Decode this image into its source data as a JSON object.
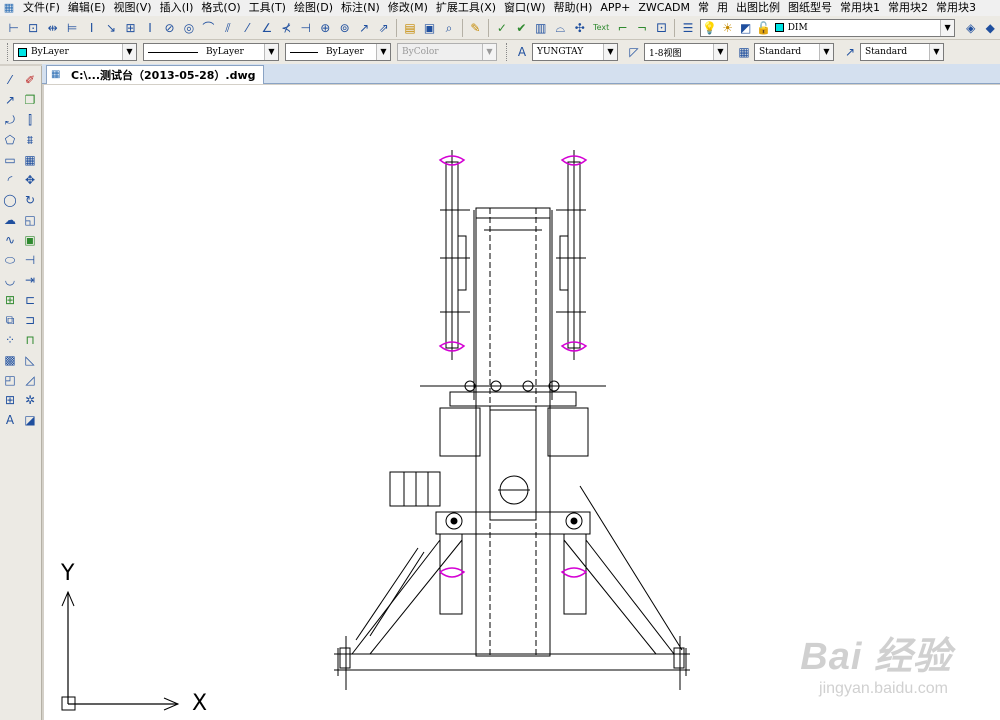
{
  "menu": [
    "文件(F)",
    "编辑(E)",
    "视图(V)",
    "插入(I)",
    "格式(O)",
    "工具(T)",
    "绘图(D)",
    "标注(N)",
    "修改(M)",
    "扩展工具(X)",
    "窗口(W)",
    "帮助(H)",
    "APP+",
    "ZWCADM",
    "常",
    "用",
    "出图比例",
    "图纸型号",
    "常用块1",
    "常用块2",
    "常用块3"
  ],
  "toolbar": {
    "text_tool": "Text",
    "layer_value": "DIM"
  },
  "properties": {
    "color": "ByLayer",
    "linetype": "ByLayer",
    "lineweight": "ByLayer",
    "plotstyle": "ByColor",
    "textstyle": "YUNGTAY",
    "dimscale": "1-8视图",
    "dimstyle": "Standard",
    "tablestyle": "Standard"
  },
  "document": {
    "tab_title": "C:\\...测试台（2013-05-28）.dwg"
  },
  "ucs": {
    "x_label": "X",
    "y_label": "Y"
  },
  "watermark": {
    "brand": "Bai 经验",
    "url": "jingyan.baidu.com"
  },
  "colors": {
    "layer_swatch": "#00e5e5",
    "highlight_magenta": "#d400d4",
    "tab_active": "#ffffff"
  }
}
